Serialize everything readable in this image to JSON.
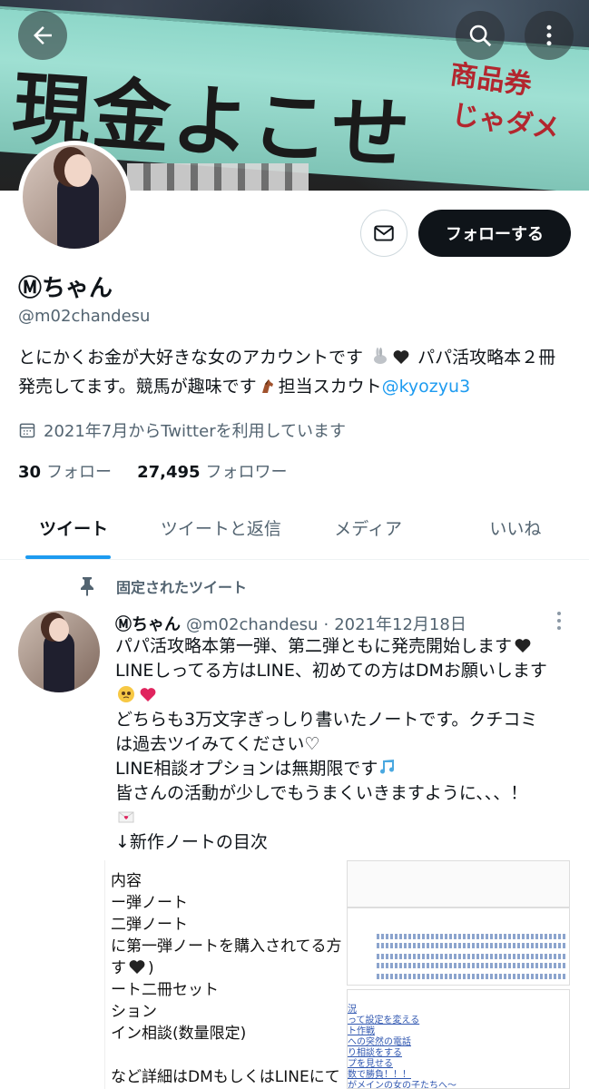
{
  "header": {
    "back_icon": "arrow-left-icon",
    "search_icon": "search-icon",
    "more_icon": "more-vertical-icon",
    "banner": {
      "slogan": "現金よこせ",
      "side_line1": "商品券",
      "side_line2": "じゃダメ"
    }
  },
  "profile": {
    "display_name": "Ⓜちゃん",
    "handle": "@m02chandesu",
    "follow_label": "フォローする",
    "bio": {
      "part1": "とにかくお金が大好きな女のアカウントです",
      "part2": "パパ活攻略本２冊発売してます。競馬が趣味です",
      "part3": "担当スカウト",
      "mention": "@kyozyu3"
    },
    "joined": "2021年7月からTwitterを利用しています",
    "following_count": "30",
    "following_label": "フォロー",
    "followers_count": "27,495",
    "followers_label": "フォロワー"
  },
  "tabs": [
    {
      "label": "ツイート",
      "active": true
    },
    {
      "label": "ツイートと返信",
      "active": false
    },
    {
      "label": "メディア",
      "active": false
    },
    {
      "label": "いいね",
      "active": false
    }
  ],
  "tweet": {
    "pinned_label": "固定されたツイート",
    "author_name": "Ⓜちゃん",
    "author_handle": "@m02chandesu",
    "separator": "·",
    "date": "2021年12月18日",
    "lines": [
      "パパ活攻略本第一弾、第二弾ともに発売開始します",
      "LINEしってる方はLINE、初めての方はDMお願いします",
      "",
      "どちらも3万文字ぎっしり書いたノートです。クチコミ",
      "は過去ツイみてください♡",
      "LINE相談オプションは無期限です",
      "皆さんの活動が少しでもうまくいきますように、、、！",
      "",
      "↓新作ノートの目次"
    ],
    "image1_lines": [
      "内容",
      "ー弾ノート",
      "二弾ノート",
      "に第一弾ノートを購入されてる方は",
      "す",
      "ート二冊セット",
      "ション",
      "イン相談(数量限定)",
      "",
      "など詳細はDMもしくはLINEにて"
    ],
    "image2_lines": [
      "況",
      "って設定を変える",
      "ト作戦",
      "への突然の電話",
      "り相談をする",
      "プを見せる",
      "数で勝負！！！",
      "がメインの女の子たちへ〜"
    ]
  },
  "colors": {
    "accent": "#1d9bf0",
    "text": "#0f1419",
    "secondary": "#536471",
    "banner_cloth": "#8ed7c9",
    "banner_red": "#b3262e"
  }
}
